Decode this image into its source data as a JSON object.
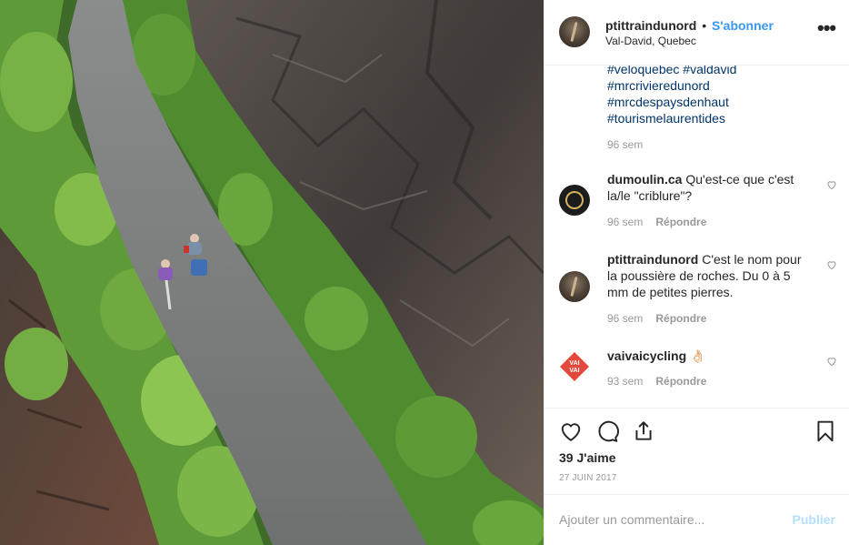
{
  "post": {
    "username": "ptittraindunord",
    "separator": "•",
    "follow_label": "S'abonner",
    "location": "Val-David, Quebec",
    "more_label": "•••"
  },
  "caption": {
    "hashtags": [
      "#veloquebec #valdavid",
      "#mrcrivieredunord",
      "#mrcdespaysdenhaut",
      "#tourismelaurentides"
    ],
    "time": "96 sem"
  },
  "comments": [
    {
      "username": "dumoulin.ca",
      "text": "Qu'est-ce que c'est la/le \"criblure\"?",
      "time": "96 sem",
      "reply_label": "Répondre"
    },
    {
      "username": "ptittraindunord",
      "text": "C'est le nom pour la poussière de roches. Du 0 à 5 mm de petites pierres.",
      "time": "96 sem",
      "reply_label": "Répondre"
    },
    {
      "username": "vaivaicycling",
      "text": "👌🏻",
      "time": "93 sem",
      "reply_label": "Répondre"
    }
  ],
  "vai_logo_text": "VAI VAI",
  "likes": "39 J'aime",
  "date": "27 JUIN 2017",
  "add_comment": {
    "placeholder": "Ajouter un commentaire...",
    "publish_label": "Publier"
  },
  "colors": {
    "link": "#3897f0",
    "hashtag": "#003569",
    "muted": "#999999",
    "publish_disabled": "#b2dffc"
  }
}
